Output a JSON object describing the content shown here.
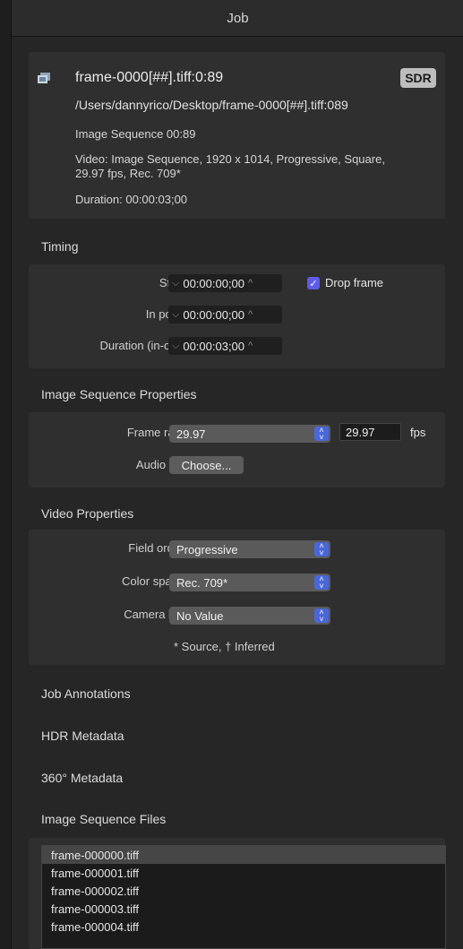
{
  "window": {
    "title": "Job"
  },
  "job": {
    "name": "frame-0000[##].tiff:0:89",
    "badge": "SDR",
    "path": "/Users/dannyrico/Desktop/frame-0000[##].tiff:089",
    "sequence": "Image Sequence 00:89",
    "video_line1": "Video: Image Sequence, 1920 x 1014, Progressive, Square,",
    "video_line2": "29.97 fps, Rec. 709*",
    "duration": "Duration: 00:00:03;00"
  },
  "timing": {
    "title": "Timing",
    "start_label": "Start:",
    "start_value": "00:00:00;00",
    "drop_frame_label": "Drop frame",
    "drop_frame_checked": true,
    "in_point_label": "In point:",
    "in_point_value": "00:00:00;00",
    "duration_label": "Duration (in-out):",
    "duration_value": "00:00:03;00"
  },
  "image_sequence_properties": {
    "title": "Image Sequence Properties",
    "frame_rate_label": "Frame rate:",
    "frame_rate_value": "29.97",
    "frame_rate_field": "29.97",
    "fps_label": "fps",
    "audio_label": "Audio file:",
    "choose_label": "Choose..."
  },
  "video_properties": {
    "title": "Video Properties",
    "field_order_label": "Field order:",
    "field_order_value": "Progressive",
    "color_space_label": "Color space:",
    "color_space_value": "Rec. 709*",
    "camera_log_label": "Camera log:",
    "camera_log_value": "No Value",
    "footnote": "* Source, † Inferred"
  },
  "collapsed_sections": {
    "annotations": "Job Annotations",
    "hdr": "HDR Metadata",
    "metadata_360": "360° Metadata",
    "files": "Image Sequence Files"
  },
  "files": [
    "frame-000000.tiff",
    "frame-000001.tiff",
    "frame-000002.tiff",
    "frame-000003.tiff",
    "frame-000004.tiff"
  ],
  "colors": {
    "accent": "#5e5ce6",
    "stepper": "#4a67d8"
  }
}
